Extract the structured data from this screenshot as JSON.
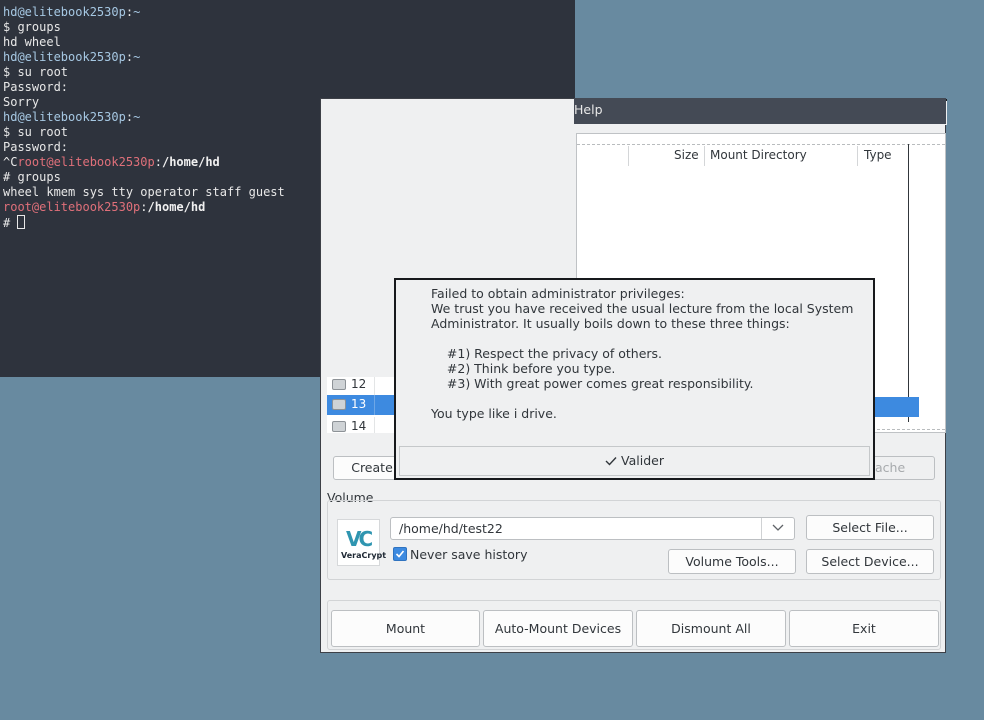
{
  "terminal": {
    "lines": [
      {
        "user": "hd@elitebook2530p",
        "sep": ":",
        "path": "~",
        "root": false
      },
      {
        "text": "$ groups"
      },
      {
        "text": "hd wheel"
      },
      {
        "user": "hd@elitebook2530p",
        "sep": ":",
        "path": "~",
        "root": false
      },
      {
        "text": "$ su root"
      },
      {
        "text": "Password:"
      },
      {
        "text": "Sorry"
      },
      {
        "user": "hd@elitebook2530p",
        "sep": ":",
        "path": "~",
        "root": false
      },
      {
        "text": "$ su root"
      },
      {
        "text": "Password:"
      },
      {
        "prefix": "^C",
        "user": "root@elitebook2530p",
        "sep": ":",
        "path": "/home/hd",
        "root": true
      },
      {
        "text": "# groups"
      },
      {
        "text": "wheel kmem sys tty operator staff guest"
      },
      {
        "user": "root@elitebook2530p",
        "sep": ":",
        "path": "/home/hd",
        "root": true
      },
      {
        "text": "# ",
        "cursor": true
      }
    ]
  },
  "veracrypt": {
    "menu_help": "Help",
    "columns": {
      "size": "Size",
      "mount_directory": "Mount Directory",
      "type": "Type"
    },
    "drives": [
      {
        "num": "12",
        "selected": false
      },
      {
        "num": "13",
        "selected": true
      },
      {
        "num": "14",
        "selected": false
      }
    ],
    "create_button": "Create",
    "cache_button": "ache",
    "volume_label": "Volume",
    "logo_text": "VeraCrypt",
    "volume_path": "/home/hd/test22",
    "never_save_history": "Never save history",
    "never_save_history_checked": true,
    "select_file": "Select File...",
    "volume_tools": "Volume Tools...",
    "select_device": "Select Device...",
    "mount": "Mount",
    "auto_mount": "Auto-Mount Devices",
    "dismount_all": "Dismount All",
    "exit": "Exit"
  },
  "dialog": {
    "lines": [
      "Failed to obtain administrator privileges:",
      "We trust you have received the usual lecture from the local System",
      "Administrator. It usually boils down to these three things:",
      "",
      "    #1) Respect the privacy of others.",
      "    #2) Think before you type.",
      "    #3) With great power comes great responsibility.",
      "",
      "You type like i drive."
    ],
    "ok_button": "Valider"
  },
  "colors": {
    "desktop": "#688aa0",
    "terminal_bg": "#2e333d",
    "user_prompt": "#a6c8e3",
    "root_prompt": "#e0707a",
    "selection": "#3d8ae0"
  }
}
